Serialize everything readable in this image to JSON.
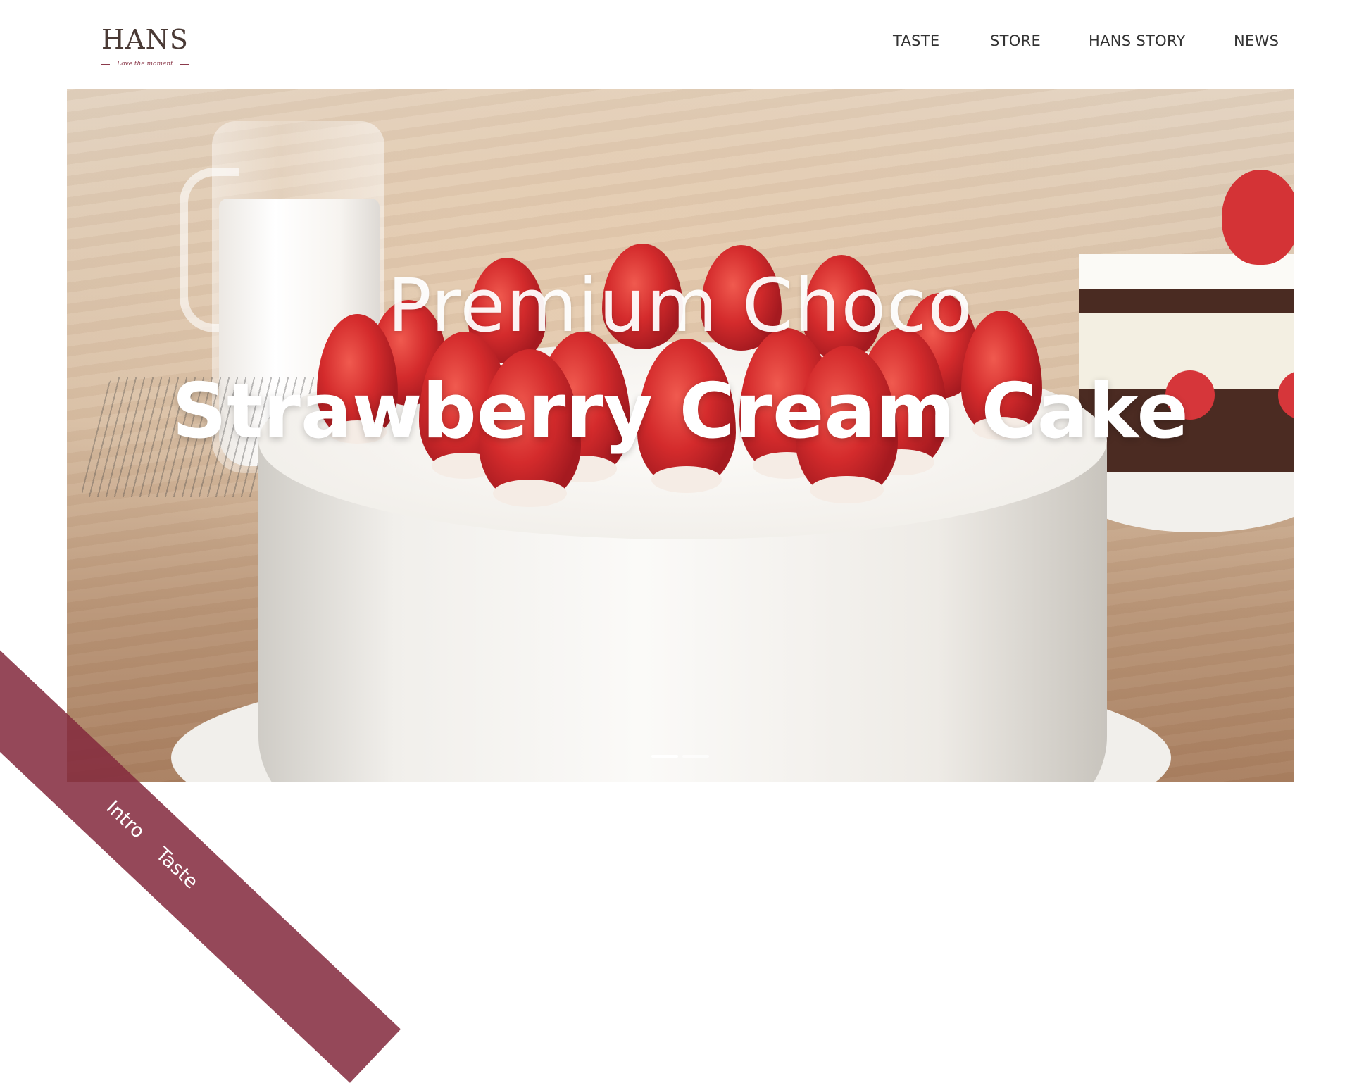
{
  "brand": {
    "name": "HANS",
    "tagline": "Love the moment",
    "accent_color": "#8b3a4b"
  },
  "nav": {
    "items": [
      "TASTE",
      "STORE",
      "HANS STORY",
      "NEWS"
    ]
  },
  "hero": {
    "title_line_1": "Premium Choco",
    "title_line_2": "Strawberry Cream Cake",
    "slides_total": 2,
    "active_slide": 1
  },
  "side_menu": {
    "items": [
      "Intro",
      "Taste"
    ],
    "color": "#842a3e"
  }
}
